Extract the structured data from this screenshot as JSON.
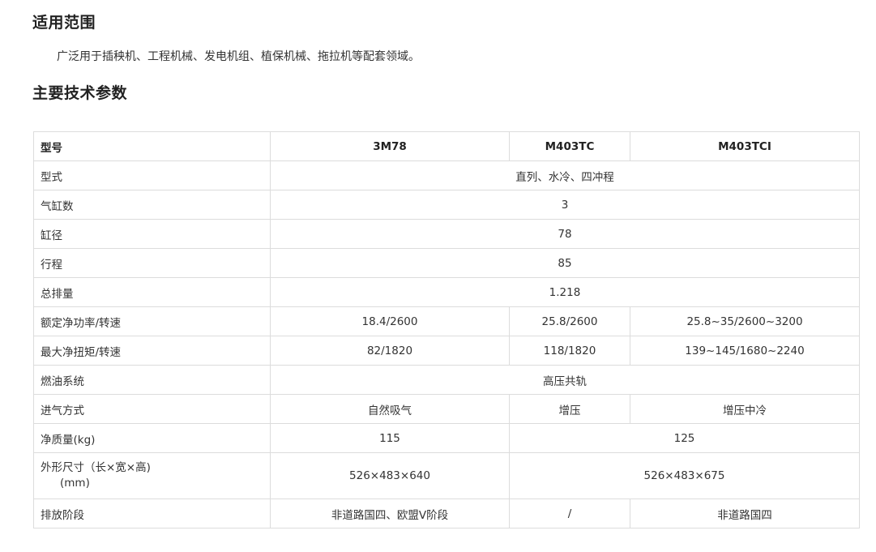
{
  "sections": {
    "scope_title": "适用范围",
    "scope_text": "广泛用于插秧机、工程机械、发电机组、植保机械、拖拉机等配套领域。",
    "params_title": "主要技术参数"
  },
  "table": {
    "header": {
      "label": "型号",
      "models": [
        "3M78",
        "M403TC",
        "M403TCI"
      ]
    },
    "rows": {
      "type": {
        "label": "型式",
        "value": "直列、水冷、四冲程"
      },
      "cylinders": {
        "label": "气缸数",
        "value": "3"
      },
      "bore": {
        "label": "缸径",
        "value": "78"
      },
      "stroke": {
        "label": "行程",
        "value": "85"
      },
      "displacement": {
        "label": "总排量",
        "value": "1.218"
      },
      "power": {
        "label": "额定净功率/转速",
        "values": [
          "18.4/2600",
          "25.8/2600",
          "25.8~35/2600~3200"
        ]
      },
      "torque": {
        "label": "最大净扭矩/转速",
        "values": [
          "82/1820",
          "118/1820",
          "139~145/1680~2240"
        ]
      },
      "fuel": {
        "label": "燃油系统",
        "value": "高压共轨"
      },
      "intake": {
        "label": "进气方式",
        "values": [
          "自然吸气",
          "增压",
          "增压中冷"
        ]
      },
      "mass": {
        "label": "净质量(kg)",
        "values": [
          "115",
          "125"
        ]
      },
      "dimensions": {
        "label_line1": "外形尺寸（长×宽×高)",
        "label_line2": "(mm)",
        "values": [
          "526×483×640",
          "526×483×675"
        ]
      },
      "emission": {
        "label": "排放阶段",
        "values": [
          "非道路国四、欧盟V阶段",
          "/",
          "非道路国四"
        ]
      }
    }
  }
}
